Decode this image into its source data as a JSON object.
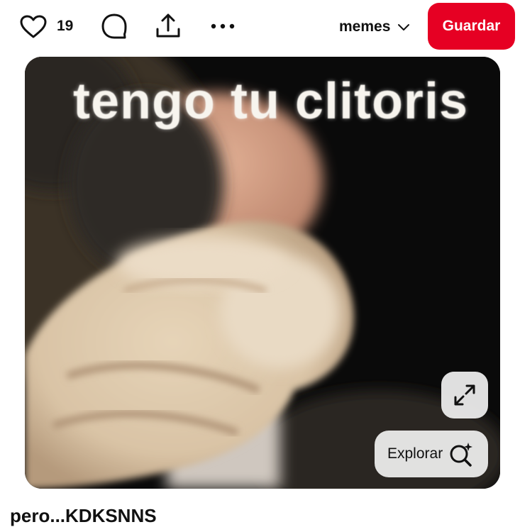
{
  "toolbar": {
    "like_count": "19",
    "like_icon": "heart-icon",
    "comment_icon": "comment-icon",
    "share_icon": "share-icon",
    "more_icon": "more-icon",
    "board_name": "memes",
    "save_label": "Guardar",
    "save_color": "#e60023"
  },
  "pin": {
    "caption": "tengo tu clitoris",
    "explore_label": "Explorar",
    "expand_icon": "expand-icon",
    "visual_search_icon": "visual-search-icon"
  },
  "title": "pero...KDKSNNS"
}
